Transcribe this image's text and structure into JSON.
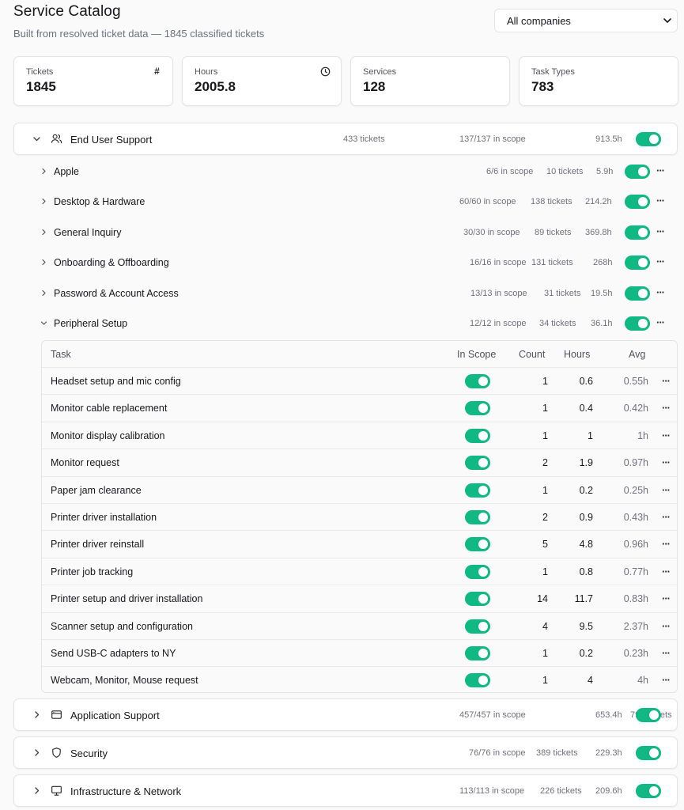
{
  "header": {
    "title": "Service Catalog",
    "subtitle": "Built from resolved ticket data — 1845 classified tickets"
  },
  "company_select": {
    "value": "All companies"
  },
  "stats": [
    {
      "label": "Tickets",
      "value": "1845",
      "icon": "hash-icon",
      "glyph": "#"
    },
    {
      "label": "Hours",
      "value": "2005.8",
      "icon": "clock-icon"
    },
    {
      "label": "Services",
      "value": "128"
    },
    {
      "label": "Task Types",
      "value": "783"
    }
  ],
  "categories": [
    {
      "name": "End User Support",
      "icon": "users-icon",
      "expanded": true,
      "scope": "137/137 in scope",
      "tickets": "433 tickets",
      "hours": "913.5h",
      "services": [
        {
          "name": "Apple",
          "scope": "6/6 in scope",
          "tickets": "10 tickets",
          "hours": "5.9h"
        },
        {
          "name": "Desktop & Hardware",
          "scope": "60/60 in scope",
          "tickets": "138 tickets",
          "hours": "214.2h"
        },
        {
          "name": "General Inquiry",
          "scope": "30/30 in scope",
          "tickets": "89 tickets",
          "hours": "369.8h"
        },
        {
          "name": "Onboarding & Offboarding",
          "scope": "16/16 in scope",
          "tickets": "131 tickets",
          "hours": "268h"
        },
        {
          "name": "Password & Account Access",
          "scope": "13/13 in scope",
          "tickets": "31 tickets",
          "hours": "19.5h"
        },
        {
          "name": "Peripheral Setup",
          "scope": "12/12 in scope",
          "tickets": "34 tickets",
          "hours": "36.1h",
          "expanded": true
        }
      ]
    },
    {
      "name": "Application Support",
      "icon": "window-icon",
      "scope": "457/457 in scope",
      "tickets": "797 tickets",
      "hours": "653.4h"
    },
    {
      "name": "Security",
      "icon": "shield-icon",
      "scope": "76/76 in scope",
      "tickets": "389 tickets",
      "hours": "229.3h"
    },
    {
      "name": "Infrastructure & Network",
      "icon": "monitor-icon",
      "scope": "113/113 in scope",
      "tickets": "226 tickets",
      "hours": "209.6h"
    }
  ],
  "task_table": {
    "columns": {
      "task": "Task",
      "in_scope": "In Scope",
      "count": "Count",
      "hours": "Hours",
      "avg": "Avg"
    },
    "rows": [
      {
        "task": "Headset setup and mic config",
        "count": "1",
        "hours": "0.6",
        "avg": "0.55h"
      },
      {
        "task": "Monitor cable replacement",
        "count": "1",
        "hours": "0.4",
        "avg": "0.42h"
      },
      {
        "task": "Monitor display calibration",
        "count": "1",
        "hours": "1",
        "avg": "1h"
      },
      {
        "task": "Monitor request",
        "count": "2",
        "hours": "1.9",
        "avg": "0.97h"
      },
      {
        "task": "Paper jam clearance",
        "count": "1",
        "hours": "0.2",
        "avg": "0.25h"
      },
      {
        "task": "Printer driver installation",
        "count": "2",
        "hours": "0.9",
        "avg": "0.43h"
      },
      {
        "task": "Printer driver reinstall",
        "count": "5",
        "hours": "4.8",
        "avg": "0.96h"
      },
      {
        "task": "Printer job tracking",
        "count": "1",
        "hours": "0.8",
        "avg": "0.77h"
      },
      {
        "task": "Printer setup and driver installation",
        "count": "14",
        "hours": "11.7",
        "avg": "0.83h"
      },
      {
        "task": "Scanner setup and configuration",
        "count": "4",
        "hours": "9.5",
        "avg": "2.37h"
      },
      {
        "task": "Send USB-C adapters to NY",
        "count": "1",
        "hours": "0.2",
        "avg": "0.23h"
      },
      {
        "task": "Webcam, Monitor, Mouse request",
        "count": "1",
        "hours": "4",
        "avg": "4h"
      }
    ]
  },
  "colors": {
    "toggle_on": "#10b981",
    "border": "#e4e4e7",
    "muted_text": "#71717a"
  },
  "more_glyph": "···"
}
